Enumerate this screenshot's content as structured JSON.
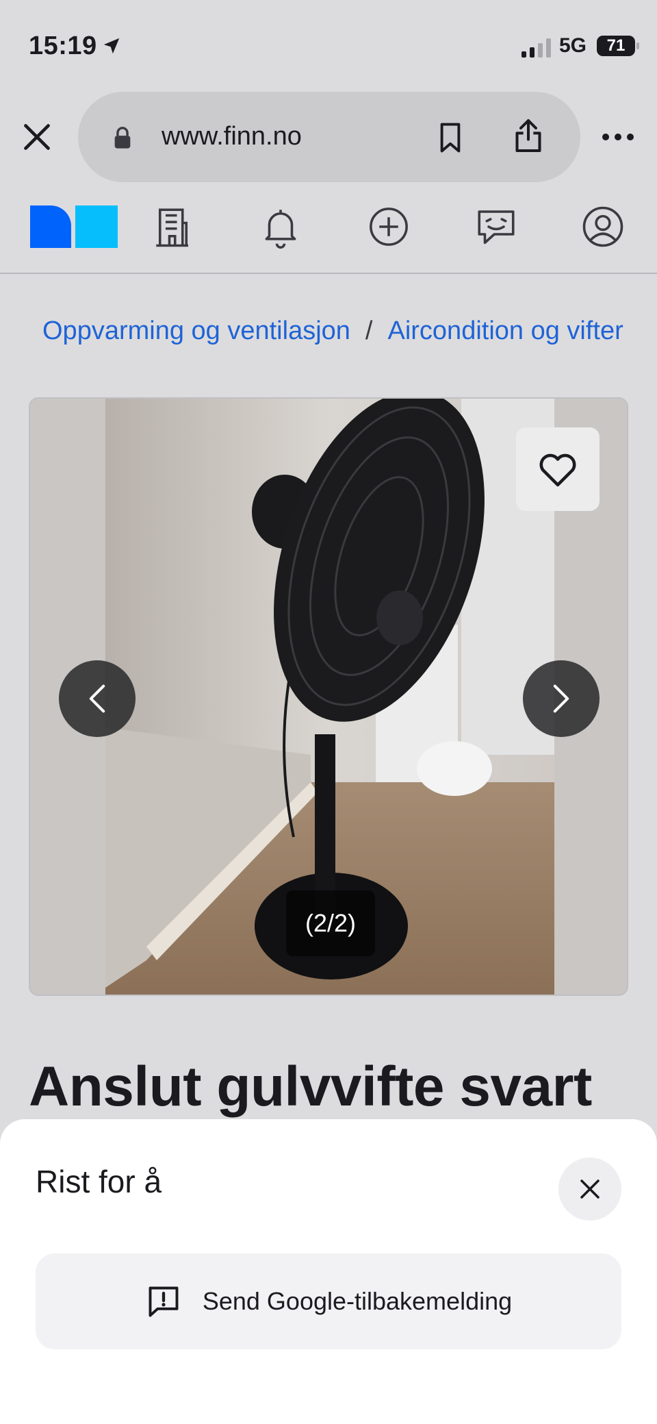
{
  "status_bar": {
    "time": "15:19",
    "network": "5G",
    "battery": "71"
  },
  "browser": {
    "url": "www.finn.no"
  },
  "nav": {
    "items": [
      "finn-logo",
      "building-icon",
      "bell-icon",
      "plus-circle-icon",
      "chat-icon",
      "profile-icon"
    ]
  },
  "breadcrumb": {
    "items": [
      "Oppvarming og ventilasjon",
      "Aircondition og vifter"
    ],
    "separator": "/"
  },
  "gallery": {
    "counter": "(2/2)"
  },
  "listing": {
    "title": "Anslut gulvvifte svart"
  },
  "sheet": {
    "title": "Rist for å",
    "feedback_label": "Send Google-tilbakemelding"
  },
  "colors": {
    "link": "#1f63d6",
    "logo_dark_blue": "#0063fb",
    "logo_light_blue": "#06befb"
  }
}
